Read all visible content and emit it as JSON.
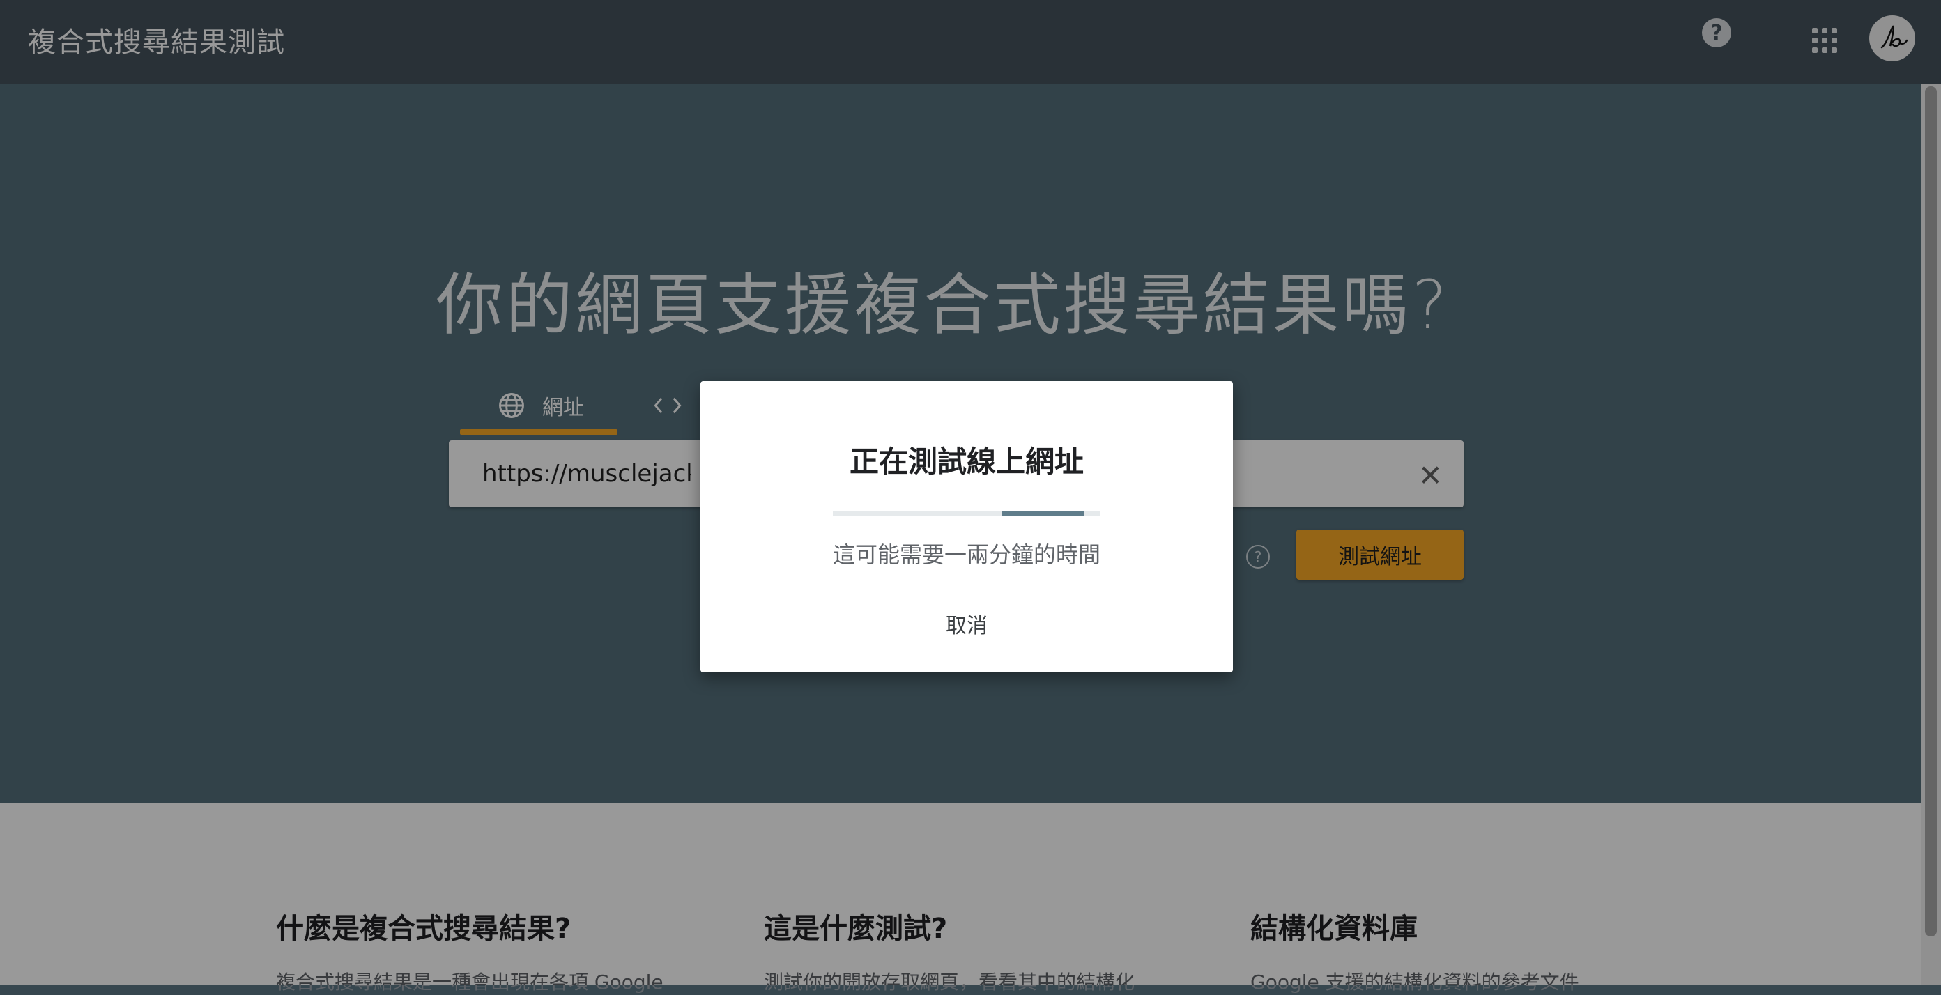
{
  "app": {
    "title": "複合式搜尋結果測試"
  },
  "header": {
    "help_glyph": "?",
    "apps_icon": "apps-grid-icon",
    "avatar_icon": "signature-avatar"
  },
  "hero": {
    "question": "你的網頁支援複合式搜尋結果嗎?",
    "tabs": [
      {
        "label": "網址",
        "icon": "globe-icon",
        "selected": true
      },
      {
        "label": "",
        "icon": "code-icon",
        "selected": false
      }
    ],
    "url_value": "https://musclejackja",
    "clear_glyph": "✕",
    "help_glyph": "?",
    "test_button_label": "測試網址"
  },
  "info": [
    {
      "title": "什麼是複合式搜尋結果?",
      "text": "複合式搜尋結果是一種會出現在各項 Google"
    },
    {
      "title": "這是什麼測試?",
      "text": "測試你的開放存取網頁，看看其中的結構化"
    },
    {
      "title": "結構化資料庫",
      "text": "Google 支援的結構化資料的參考文件"
    }
  ],
  "dialog": {
    "title": "正在測試線上網址",
    "progress_start": 0.63,
    "progress_end": 0.94,
    "subtitle": "這可能需要一兩分鐘的時間",
    "cancel_label": "取消"
  },
  "colors": {
    "accent": "#f9a825",
    "hero_bg": "#546e7a",
    "appbar_bg": "#45535c",
    "progress": "#607d8b"
  }
}
